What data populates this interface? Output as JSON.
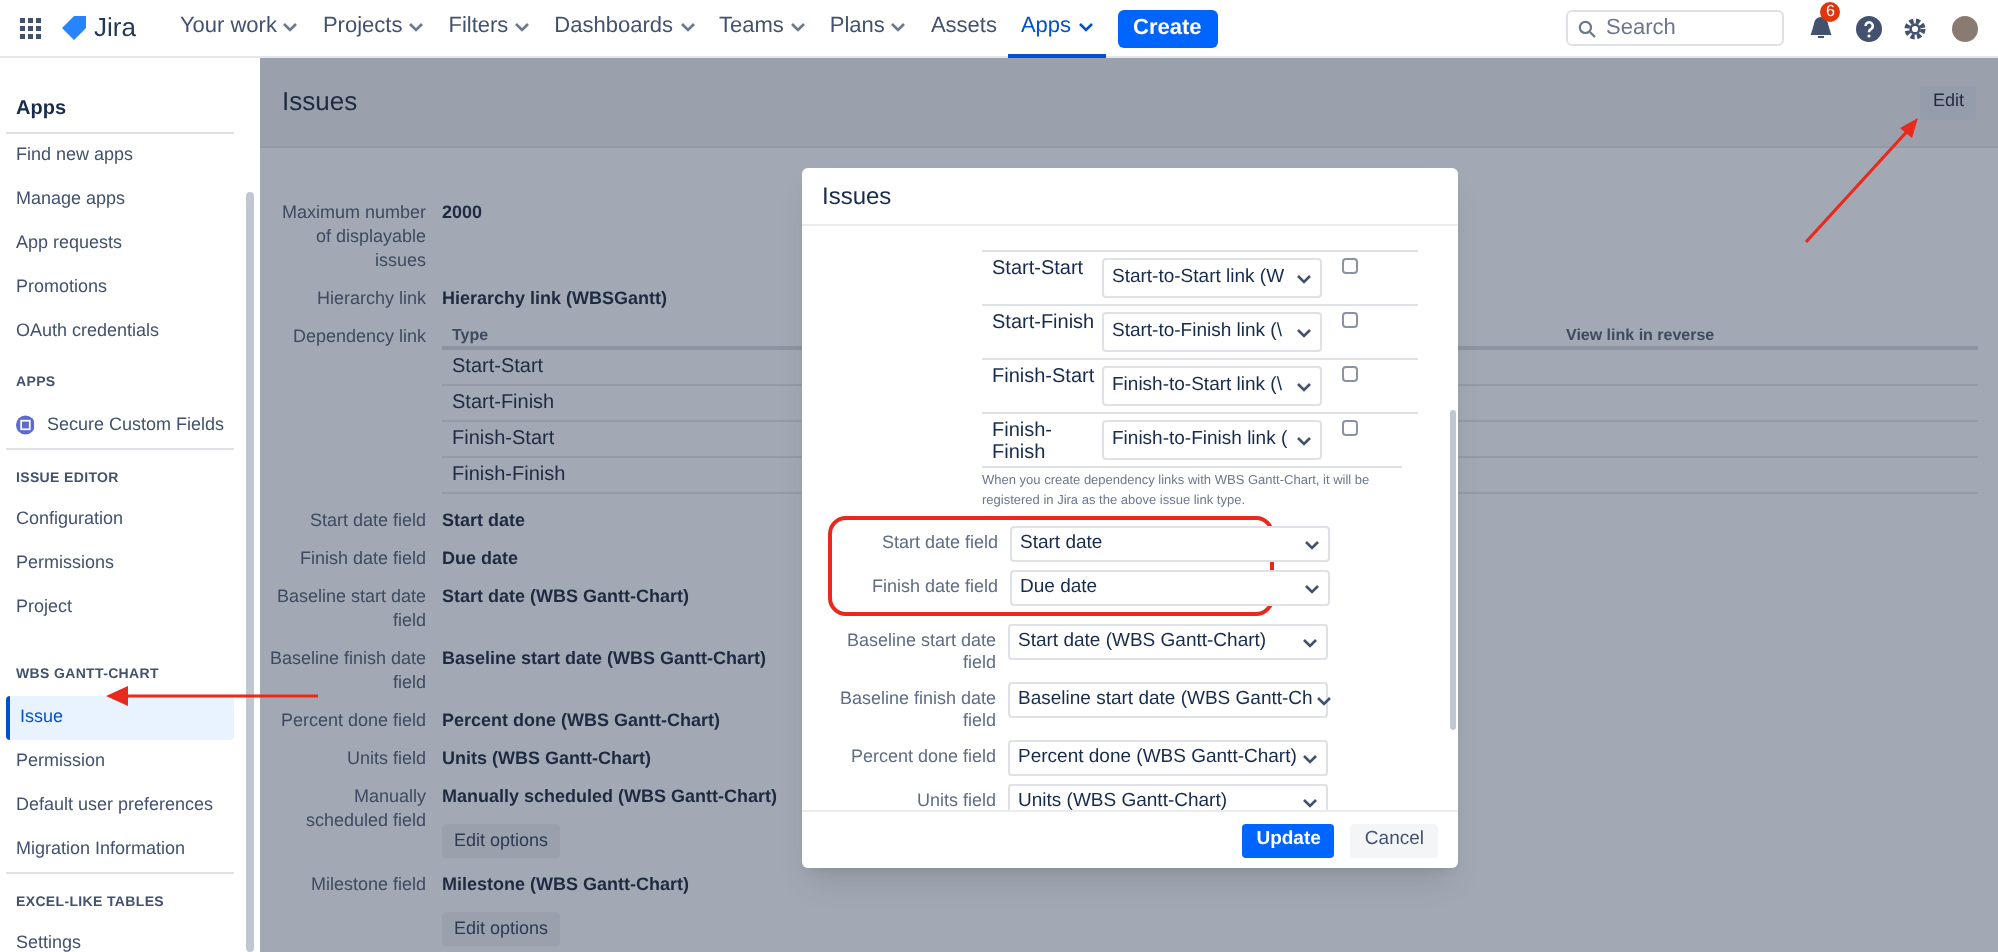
{
  "nav": {
    "product": "Jira",
    "items": [
      {
        "label": "Your work",
        "dropdown": true,
        "selected": false
      },
      {
        "label": "Projects",
        "dropdown": true,
        "selected": false
      },
      {
        "label": "Filters",
        "dropdown": true,
        "selected": false
      },
      {
        "label": "Dashboards",
        "dropdown": true,
        "selected": false
      },
      {
        "label": "Teams",
        "dropdown": true,
        "selected": false
      },
      {
        "label": "Plans",
        "dropdown": true,
        "selected": false
      },
      {
        "label": "Assets",
        "dropdown": false,
        "selected": false
      },
      {
        "label": "Apps",
        "dropdown": true,
        "selected": true
      }
    ],
    "create": "Create",
    "search": {
      "placeholder": "Search"
    },
    "notification_count": "6"
  },
  "sidebar": {
    "title": "Apps",
    "sections": [
      {
        "items": [
          {
            "label": "Find new apps",
            "selected": false
          },
          {
            "label": "Manage apps",
            "selected": false
          },
          {
            "label": "App requests",
            "selected": false
          },
          {
            "label": "Promotions",
            "selected": false
          },
          {
            "label": "OAuth credentials",
            "selected": false
          }
        ]
      },
      {
        "heading": "APPS",
        "items": [
          {
            "label": "Secure Custom Fields",
            "selected": false,
            "kind": "app"
          }
        ]
      },
      {
        "heading": "ISSUE EDITOR",
        "items": [
          {
            "label": "Configuration",
            "selected": false
          },
          {
            "label": "Permissions",
            "selected": false
          },
          {
            "label": "Project",
            "selected": false
          }
        ]
      },
      {
        "heading": "WBS GANTT-CHART",
        "items": [
          {
            "label": "Issue",
            "selected": true
          },
          {
            "label": "Permission",
            "selected": false
          },
          {
            "label": "Default user preferences",
            "selected": false
          },
          {
            "label": "Migration Information",
            "selected": false
          }
        ]
      },
      {
        "heading": "EXCEL-LIKE TABLES",
        "items": [
          {
            "label": "Settings",
            "selected": false
          }
        ]
      }
    ]
  },
  "main": {
    "title": "Issues",
    "edit": "Edit",
    "fields": [
      {
        "kind": "text",
        "label": "Maximum number of displayable issues",
        "value": "2000"
      },
      {
        "kind": "text",
        "label": "Hierarchy link",
        "value": "Hierarchy link (WBSGantt)"
      },
      {
        "kind": "table",
        "label": "Dependency link",
        "columns": [
          "Type",
          "View link in reverse"
        ],
        "rows": [
          "Start-Start",
          "Start-Finish",
          "Finish-Start",
          "Finish-Finish"
        ]
      },
      {
        "kind": "text",
        "label": "Start date field",
        "value": "Start date"
      },
      {
        "kind": "text",
        "label": "Finish date field",
        "value": "Due date"
      },
      {
        "kind": "text",
        "label": "Baseline start date field",
        "value": "Start date (WBS Gantt-Chart)"
      },
      {
        "kind": "text",
        "label": "Baseline finish date field",
        "value": "Baseline start date (WBS Gantt-Chart)"
      },
      {
        "kind": "text",
        "label": "Percent done field",
        "value": "Percent done (WBS Gantt-Chart)"
      },
      {
        "kind": "text",
        "label": "Units field",
        "value": "Units (WBS Gantt-Chart)"
      },
      {
        "kind": "text",
        "label": "Manually scheduled field",
        "value": "Manually scheduled (WBS Gantt-Chart)",
        "button": "Edit options"
      },
      {
        "kind": "text",
        "label": "Milestone field",
        "value": "Milestone (WBS Gantt-Chart)",
        "button": "Edit options"
      }
    ]
  },
  "dialog": {
    "title": "Issues",
    "links": [
      {
        "type": "Start-Start",
        "value": "Start-to-Start link (W",
        "checked": false
      },
      {
        "type": "Start-Finish",
        "value": "Start-to-Finish link (\\",
        "checked": false
      },
      {
        "type": "Finish-Start",
        "value": "Finish-to-Start link (\\",
        "checked": false
      },
      {
        "type": "Finish-Finish",
        "value": "Finish-to-Finish link (",
        "checked": false
      }
    ],
    "note": "When you create dependency links with WBS Gantt-Chart, it will be registered in Jira as the above issue link type.",
    "fields": [
      {
        "label": "Start date field",
        "value": "Start date",
        "highlighted": true
      },
      {
        "label": "Finish date field",
        "value": "Due date",
        "highlighted": true
      },
      {
        "label": "Baseline start date field",
        "value": "Start date (WBS Gantt-Chart)",
        "highlighted": false
      },
      {
        "label": "Baseline finish date field",
        "value": "Baseline start date (WBS Gantt-Ch",
        "highlighted": false
      },
      {
        "label": "Percent done field",
        "value": "Percent done (WBS Gantt-Chart)",
        "highlighted": false
      },
      {
        "label": "Units field",
        "value": "Units (WBS Gantt-Chart)",
        "highlighted": false
      }
    ],
    "buttons": [
      {
        "label": "Update",
        "kind": "primary"
      },
      {
        "label": "Cancel",
        "kind": "secondary"
      }
    ]
  }
}
